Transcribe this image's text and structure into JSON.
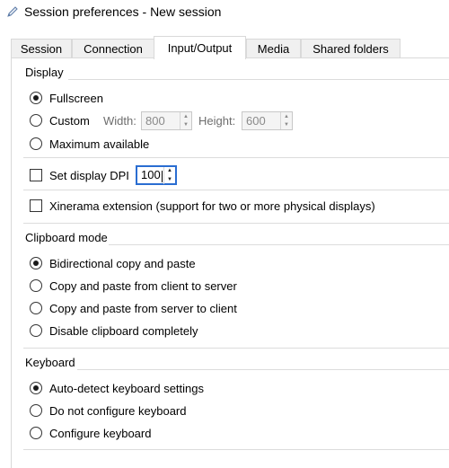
{
  "window": {
    "title": "Session preferences - New session"
  },
  "tabs": [
    {
      "label": "Session"
    },
    {
      "label": "Connection"
    },
    {
      "label": "Input/Output"
    },
    {
      "label": "Media"
    },
    {
      "label": "Shared folders"
    }
  ],
  "active_tab": "Input/Output",
  "display": {
    "title": "Display",
    "fullscreen": "Fullscreen",
    "custom": "Custom",
    "width_label": "Width:",
    "width_value": "800",
    "height_label": "Height:",
    "height_value": "600",
    "maximum": "Maximum available",
    "selected": "Fullscreen",
    "set_dpi": "Set display DPI",
    "dpi_value": "100",
    "xinerama": "Xinerama extension (support for two or more physical displays)"
  },
  "clipboard": {
    "title": "Clipboard mode",
    "options": [
      "Bidirectional copy and paste",
      "Copy and paste from client to server",
      "Copy and paste from server to client",
      "Disable clipboard completely"
    ],
    "selected": "Bidirectional copy and paste"
  },
  "keyboard": {
    "title": "Keyboard",
    "options": [
      "Auto-detect keyboard settings",
      "Do not configure keyboard",
      "Configure keyboard"
    ],
    "selected": "Auto-detect keyboard settings"
  },
  "colors": {
    "focus_border": "#2a6dd1",
    "separator": "#dcdcdc",
    "tab_inactive": "#f0f0f0"
  }
}
